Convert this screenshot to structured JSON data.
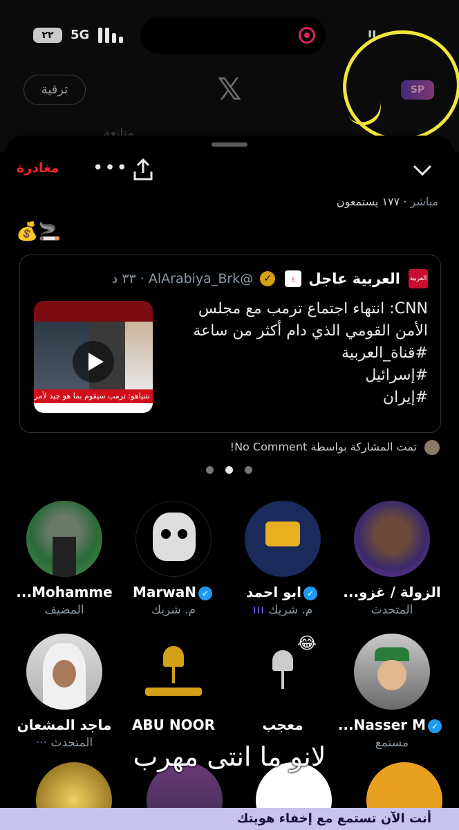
{
  "status_bar": {
    "battery": "٢٢",
    "network": "5G"
  },
  "background_app": {
    "upgrade_label": "ترقية",
    "x_logo": "𝕏",
    "spaces_logo": "SP",
    "tabs_hint": "متابعة"
  },
  "sheet": {
    "leave_label": "مغادرة",
    "more_label": "•••",
    "live_label": "مباشر",
    "listeners_label": "· ١٧٧ يستمعون",
    "emojis": "💰🚬"
  },
  "tweet": {
    "name": "العربية عاجل",
    "handle": "@AlArabiya_Brk",
    "time": "· ٣٣ د",
    "text_lines": [
      "CNN: انتهاء اجتماع ترمب مع مجلس",
      "الأمن القومي الذي دام أكثر من ساعة",
      "#قناة_العربية",
      "#إسرائيل",
      "#إيران"
    ],
    "media_ticker": "نتنياهو: ترمب سيقوم بما هو جيد لأمريكا ولا أت >",
    "avatar_label": "العربية"
  },
  "shared_by": "تمت المشاركة بواسطة No Comment!",
  "participants": [
    {
      "name": "الزولة / غزو...",
      "role": "المتحدث",
      "verified": false,
      "speaking": false
    },
    {
      "name": "ابو احمد",
      "role": "م. شريك",
      "verified": true,
      "speaking": true
    },
    {
      "name": "MarwaN",
      "role": "م. شريك",
      "verified": true,
      "speaking": false
    },
    {
      "name": "Mohamme...",
      "role": "المضيف",
      "verified": false,
      "speaking": false
    },
    {
      "name": "Nasser M...",
      "role": "مستمع",
      "verified": true,
      "speaking": false
    },
    {
      "name": "معجب",
      "role": "",
      "verified": false,
      "speaking": false
    },
    {
      "name": "ABU NOOR",
      "role": "",
      "verified": false,
      "speaking": false
    },
    {
      "name": "ماجد المشعان",
      "role": "المتحدث",
      "verified": false,
      "speaking": true
    }
  ],
  "emoji_reaction": "😂",
  "caption": "لانو ما انتى مهرب",
  "banner": "أنت الآن تستمع مع إخفاء هويتك",
  "colors": {
    "leave": "#f4212e",
    "verified": "#1d9bf0",
    "annotation": "#f1e63b",
    "banner": "#c8c2f0"
  }
}
